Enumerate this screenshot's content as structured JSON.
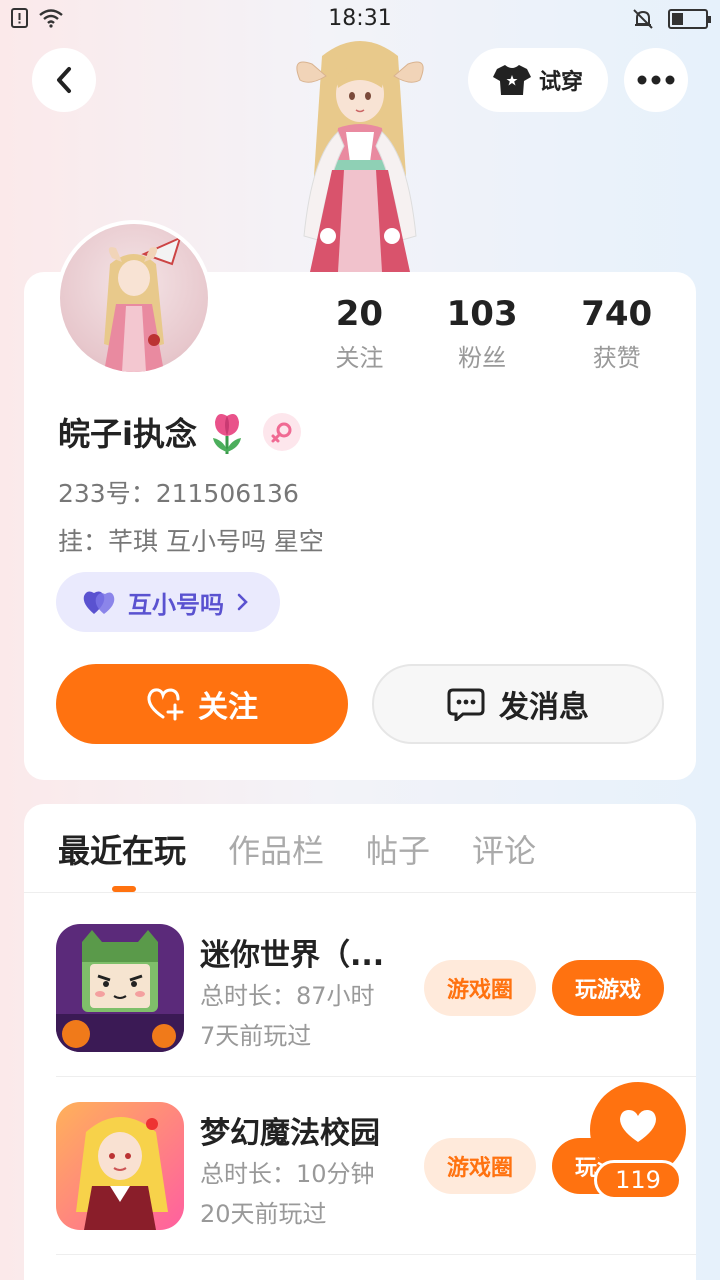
{
  "status_bar": {
    "time": "18:31",
    "battery_level": 0.35
  },
  "header": {
    "back_icon": "chevron-left-icon",
    "try_on_label": "试穿",
    "more_icon": "more-horizontal-icon"
  },
  "profile": {
    "stats": [
      {
        "value": "20",
        "label": "关注"
      },
      {
        "value": "103",
        "label": "粉丝"
      },
      {
        "value": "740",
        "label": "获赞"
      }
    ],
    "name": "皖子i执念",
    "uid": "233号：211506136",
    "signature": "挂：芊琪  互小号吗  星空",
    "group_chip": "互小号吗",
    "follow_label": "关注",
    "message_label": "发消息"
  },
  "tabs": [
    {
      "label": "最近在玩",
      "active": true
    },
    {
      "label": "作品栏",
      "active": false
    },
    {
      "label": "帖子",
      "active": false
    },
    {
      "label": "评论",
      "active": false
    }
  ],
  "games": [
    {
      "title": "迷你世界（...",
      "duration": "总时长：87小时",
      "last_played": "7天前玩过",
      "circle_label": "游戏圈",
      "play_label": "玩游戏"
    },
    {
      "title": "梦幻魔法校园",
      "duration": "总时长：10分钟",
      "last_played": "20天前玩过",
      "circle_label": "游戏圈",
      "play_label": "玩游戏"
    }
  ],
  "floating_like": {
    "count": "119"
  },
  "colors": {
    "accent": "#ff7210",
    "accent_light": "#ffeadb",
    "group_chip_bg": "#eaeafd",
    "group_chip_text": "#5a52d0"
  }
}
